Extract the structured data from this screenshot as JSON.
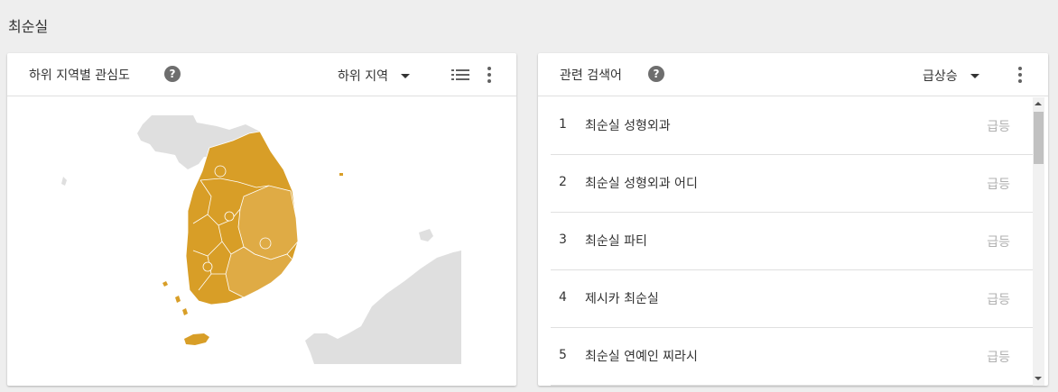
{
  "page": {
    "title": "최순실"
  },
  "region_card": {
    "title": "하위 지역별 관심도",
    "help": "?",
    "dropdown_label": "하위 지역",
    "list_view_icon": "list-icon",
    "more_icon": "more-vert-icon",
    "map": {
      "highlight_color": "#d89e27",
      "light_color": "#dfab45",
      "land_color": "#dfdfdf"
    }
  },
  "related_card": {
    "title": "관련 검색어",
    "help": "?",
    "dropdown_label": "급상승",
    "more_icon": "more-vert-icon",
    "rows": [
      {
        "rank": "1",
        "query": "최순실 성형외과",
        "value": "급등"
      },
      {
        "rank": "2",
        "query": "최순실 성형외과 어디",
        "value": "급등"
      },
      {
        "rank": "3",
        "query": "최순실 파티",
        "value": "급등"
      },
      {
        "rank": "4",
        "query": "제시카 최순실",
        "value": "급등"
      },
      {
        "rank": "5",
        "query": "최순실 연예인 찌라시",
        "value": "급등"
      }
    ]
  }
}
